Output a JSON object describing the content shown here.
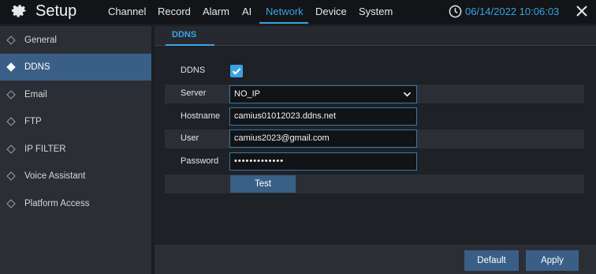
{
  "header": {
    "title": "Setup",
    "tabs": [
      {
        "label": "Channel"
      },
      {
        "label": "Record"
      },
      {
        "label": "Alarm"
      },
      {
        "label": "AI"
      },
      {
        "label": "Network"
      },
      {
        "label": "Device"
      },
      {
        "label": "System"
      }
    ],
    "active_tab": "Network",
    "datetime": "06/14/2022 10:06:03"
  },
  "sidebar": {
    "items": [
      {
        "label": "General"
      },
      {
        "label": "DDNS"
      },
      {
        "label": "Email"
      },
      {
        "label": "FTP"
      },
      {
        "label": "IP FILTER"
      },
      {
        "label": "Voice Assistant"
      },
      {
        "label": "Platform Access"
      }
    ],
    "active_item": "DDNS"
  },
  "subtab": {
    "label": "DDNS"
  },
  "form": {
    "ddns_label": "DDNS",
    "ddns_enabled": true,
    "server_label": "Server",
    "server_value": "NO_IP",
    "hostname_label": "Hostname",
    "hostname_value": "camius01012023.ddns.net",
    "user_label": "User",
    "user_value": "camius2023@gmail.com",
    "password_label": "Password",
    "password_value": "•••••••••••••",
    "test_label": "Test"
  },
  "footer": {
    "default_label": "Default",
    "apply_label": "Apply"
  },
  "colors": {
    "accent": "#3aa3e3",
    "active_bg": "#3a5f86",
    "topbar_bg": "#121417",
    "sidebar_bg": "#2b2f35",
    "content_bg": "#1e2126"
  },
  "icons": {
    "logo": "gear-icon",
    "clock": "clock-icon",
    "close": "close-icon",
    "checkbox": "check-icon",
    "select": "chevron-down-icon",
    "sidebar_bullet": "diamond-icon"
  }
}
